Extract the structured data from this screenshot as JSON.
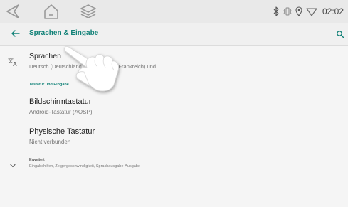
{
  "system_bar": {
    "clock": "02:02"
  },
  "app_bar": {
    "title": "Sprachen & Eingabe"
  },
  "sprachen": {
    "title": "Sprachen",
    "subtitle": "Deutsch (Deutschland), Französisch (Frankreich) und ..."
  },
  "section": {
    "header": "Tastatur und Eingabe"
  },
  "bildschirmtastatur": {
    "title": "Bildschirmtastatur",
    "subtitle": "Android-Tastatur (AOSP)"
  },
  "physische_tastatur": {
    "title": "Physische Tastatur",
    "subtitle": "Nicht verbunden"
  },
  "erweitert": {
    "title": "Erweitert",
    "subtitle": "Eingabehilfen, Zeigergeschwindigkeit, Sprachausgabe-Ausgabe"
  },
  "colors": {
    "accent": "#128278",
    "background": "#f5f5f5",
    "system_bar": "#e9e9e9"
  },
  "icons": {
    "back": "back-triangle-icon",
    "home": "home-icon",
    "recents": "layers-icon",
    "bluetooth": "bluetooth-icon",
    "vibrate": "vibrate-icon",
    "location": "location-icon",
    "wifi": "wifi-icon",
    "translate": "translate-icon",
    "expand": "chevron-down-icon"
  }
}
